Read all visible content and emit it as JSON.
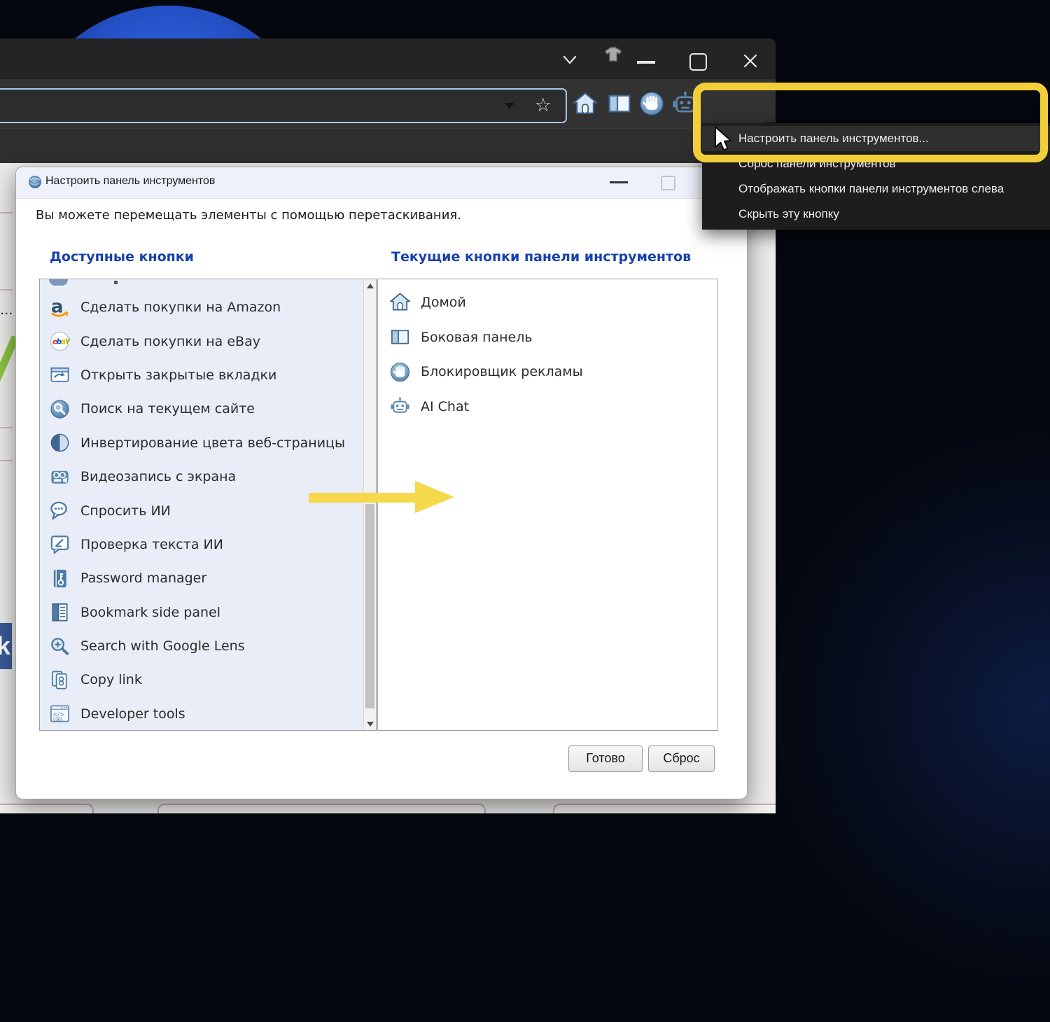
{
  "browser": {
    "window_control_icons": [
      "chevron-down-icon",
      "skin-tshirt-icon",
      "minimize-icon",
      "maximize-icon",
      "close-icon"
    ],
    "addressbar_icons": [
      "history-dropdown-icon",
      "bookmark-star-icon"
    ],
    "toolbar_icons": [
      "home-icon",
      "side-panel-icon",
      "ad-blocker-icon",
      "ai-chat-icon",
      "toolbar-overflow-icon",
      "profile-icon",
      "settings-gear-icon"
    ]
  },
  "context_menu": {
    "items": [
      "Настроить панель инструментов...",
      "Сброс панели инструментов",
      "Отображать кнопки панели инструментов слева",
      "Скрыть эту кнопку"
    ]
  },
  "dialog": {
    "title": "Настроить панель инструментов",
    "instruction": "Вы можете перемещать элементы с помощью перетаскивания.",
    "left_column_header": "Доступные кнопки",
    "right_column_header": "Текущие кнопки панели инструментов",
    "available_buttons": [
      {
        "label": "Сделать покупки на Amazon",
        "icon": "amazon-icon"
      },
      {
        "label": "Сделать покупки на eBay",
        "icon": "ebay-icon"
      },
      {
        "label": "Открыть закрытые вкладки",
        "icon": "reopen-tabs-icon"
      },
      {
        "label": "Поиск на текущем сайте",
        "icon": "site-search-icon"
      },
      {
        "label": "Инвертирование цвета веб-страницы",
        "icon": "invert-colors-icon"
      },
      {
        "label": "Видеозапись с экрана",
        "icon": "screen-record-icon"
      },
      {
        "label": "Спросить ИИ",
        "icon": "ask-ai-icon"
      },
      {
        "label": "Проверка текста ИИ",
        "icon": "ai-text-check-icon"
      },
      {
        "label": "Password manager",
        "icon": "password-manager-icon"
      },
      {
        "label": "Bookmark side panel",
        "icon": "bookmark-panel-icon"
      },
      {
        "label": "Search with Google Lens",
        "icon": "google-lens-icon"
      },
      {
        "label": "Copy link",
        "icon": "copy-link-icon"
      },
      {
        "label": "Developer tools",
        "icon": "dev-tools-icon"
      }
    ],
    "current_buttons": [
      {
        "label": "Домой",
        "icon": "home-icon"
      },
      {
        "label": "Боковая панель",
        "icon": "side-panel-icon"
      },
      {
        "label": "Блокировщик рекламы",
        "icon": "ad-blocker-icon"
      },
      {
        "label": "AI Chat",
        "icon": "ai-chat-icon"
      }
    ],
    "done_label": "Готово",
    "reset_label": "Сброс"
  },
  "webpage_fragment": {
    "badge_letter": "k",
    "ellipsis": "..."
  },
  "colors": {
    "annotation_yellow": "#f2cf3a",
    "header_blue": "#1641ad",
    "steel_icon_blue": "#4a7aa8",
    "menu_bg": "#1d1d1d",
    "dialog_titlebar": "#eef1fa"
  }
}
